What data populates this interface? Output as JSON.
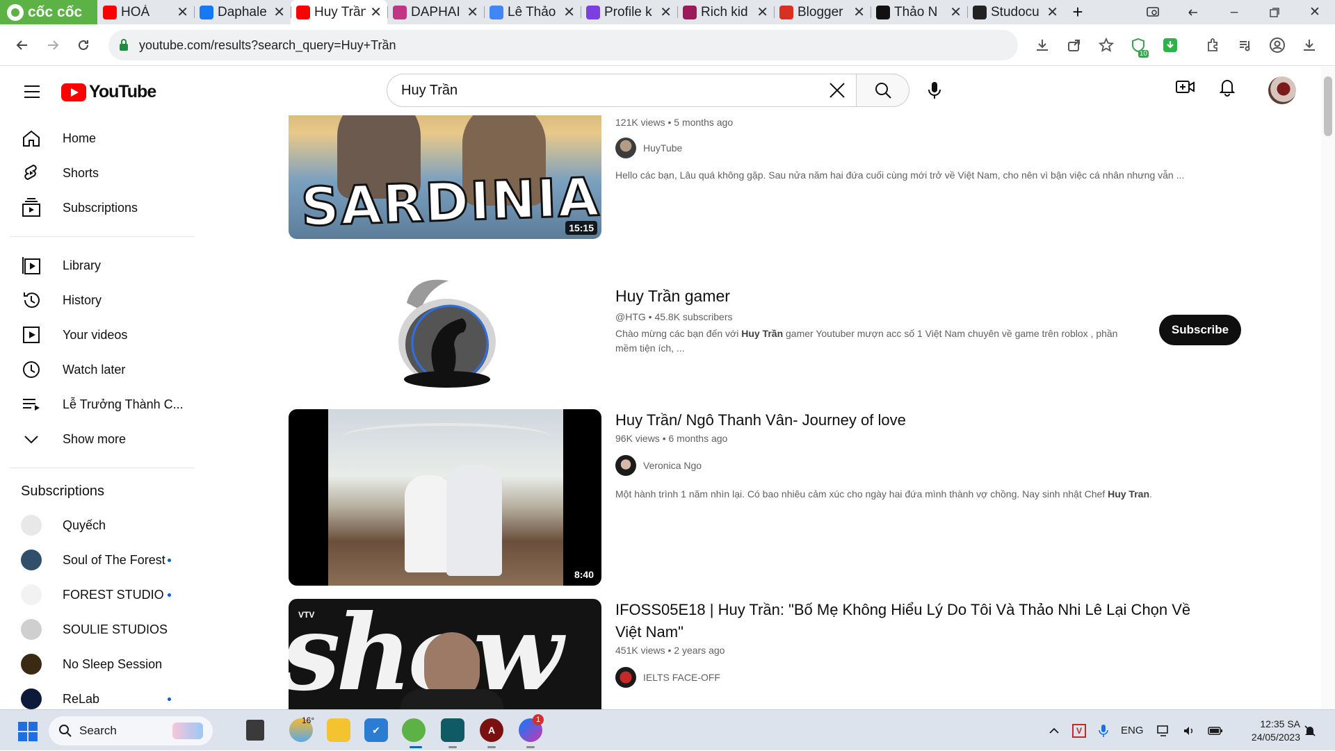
{
  "browser": {
    "logo_text": "cốc cốc",
    "tabs": [
      {
        "title": "HOÀ",
        "favicon_color": "#ff0000",
        "active": false
      },
      {
        "title": "Daphale",
        "favicon_color": "#1877f2",
        "active": false
      },
      {
        "title": "Huy Trần",
        "favicon_color": "#ff0000",
        "active": true
      },
      {
        "title": "DAPHAI",
        "favicon_color": "#c13584",
        "active": false
      },
      {
        "title": "Lê Thảo",
        "favicon_color": "#4285f4",
        "active": false
      },
      {
        "title": "Profile k",
        "favicon_color": "#7b3fe4",
        "active": false
      },
      {
        "title": "Rich kid",
        "favicon_color": "#9b1b5a",
        "active": false
      },
      {
        "title": "Blogger",
        "favicon_color": "#d93025",
        "active": false
      },
      {
        "title": "Thảo N",
        "favicon_color": "#111111",
        "active": false
      },
      {
        "title": "Studocu",
        "favicon_color": "#222222",
        "active": false
      }
    ],
    "url": "youtube.com/results?search_query=Huy+Trần",
    "extension_badge": "10"
  },
  "youtube": {
    "logo_text": "YouTube",
    "search_value": "Huy Trần",
    "sidebar": {
      "main": [
        {
          "label": "Home",
          "icon": "home-icon"
        },
        {
          "label": "Shorts",
          "icon": "shorts-icon"
        },
        {
          "label": "Subscriptions",
          "icon": "subscriptions-icon"
        }
      ],
      "library": [
        {
          "label": "Library",
          "icon": "library-icon"
        },
        {
          "label": "History",
          "icon": "history-icon"
        },
        {
          "label": "Your videos",
          "icon": "your-videos-icon"
        },
        {
          "label": "Watch later",
          "icon": "clock-icon"
        },
        {
          "label": "Lễ Trưởng Thành C...",
          "icon": "playlist-icon"
        },
        {
          "label": "Show more",
          "icon": "chevron-down-icon"
        }
      ],
      "subscriptions_heading": "Subscriptions",
      "subscriptions": [
        {
          "label": "Quyếch",
          "color": "#e8e8e8",
          "new": false
        },
        {
          "label": "Soul of The Forest",
          "color": "#2f4f6b",
          "new": true
        },
        {
          "label": "FOREST STUDIO",
          "color": "#f2f2f2",
          "new": true
        },
        {
          "label": "SOULIE STUDIOS",
          "color": "#cfcfcf",
          "new": false
        },
        {
          "label": "No Sleep Session",
          "color": "#3a2a14",
          "new": false
        },
        {
          "label": "ReLab",
          "color": "#0d1a3a",
          "new": true
        }
      ]
    },
    "results": [
      {
        "type": "video",
        "meta": "121K views • 5 months ago",
        "channel": "HuyTube",
        "description": "Hello các bạn, Lâu quá không gặp. Sau nửa năm hai đứa cuối cùng mới trở về Việt Nam, cho nên vì bận việc cá nhân nhưng vẫn ...",
        "thumb_text": "SARDINIA",
        "duration": "15:15"
      },
      {
        "type": "channel",
        "title": "Huy Trần gamer",
        "meta": "@HTG • 45.8K subscribers",
        "desc_before": "Chào mừng các bạn đến với ",
        "desc_bold": "Huy Trần",
        "desc_after": " gamer Youtuber mượn acc số 1 Việt Nam chuyên về game trên roblox , phần mềm tiện ích, ...",
        "subscribe_label": "Subscribe"
      },
      {
        "type": "video",
        "title": "Huy Trần/ Ngô Thanh Vân- Journey of love",
        "meta": "96K views • 6 months ago",
        "channel": "Veronica Ngo",
        "desc_before": "Một hành trình 1 năm nhìn lại. Có bao nhiêu cảm xúc cho ngày hai đứa mình thành vợ chồng. Nay sinh nhật Chef ",
        "desc_bold": "Huy Tran",
        "desc_after": ".",
        "duration": "8:40"
      },
      {
        "type": "video",
        "title": "IFOSS05E18 | Huy Trần: \"Bố Mẹ Không Hiểu Lý Do Tôi Và Thảo Nhi Lê Lại Chọn Về Việt Nam\"",
        "meta": "451K views • 2 years ago",
        "channel": "IELTS FACE-OFF",
        "thumb_text": "show"
      }
    ]
  },
  "taskbar": {
    "search_label": "Search",
    "weather_temp": "16°",
    "messenger_badge": "1",
    "language": "ENG",
    "time": "12:35 SA",
    "date": "24/05/2023"
  }
}
